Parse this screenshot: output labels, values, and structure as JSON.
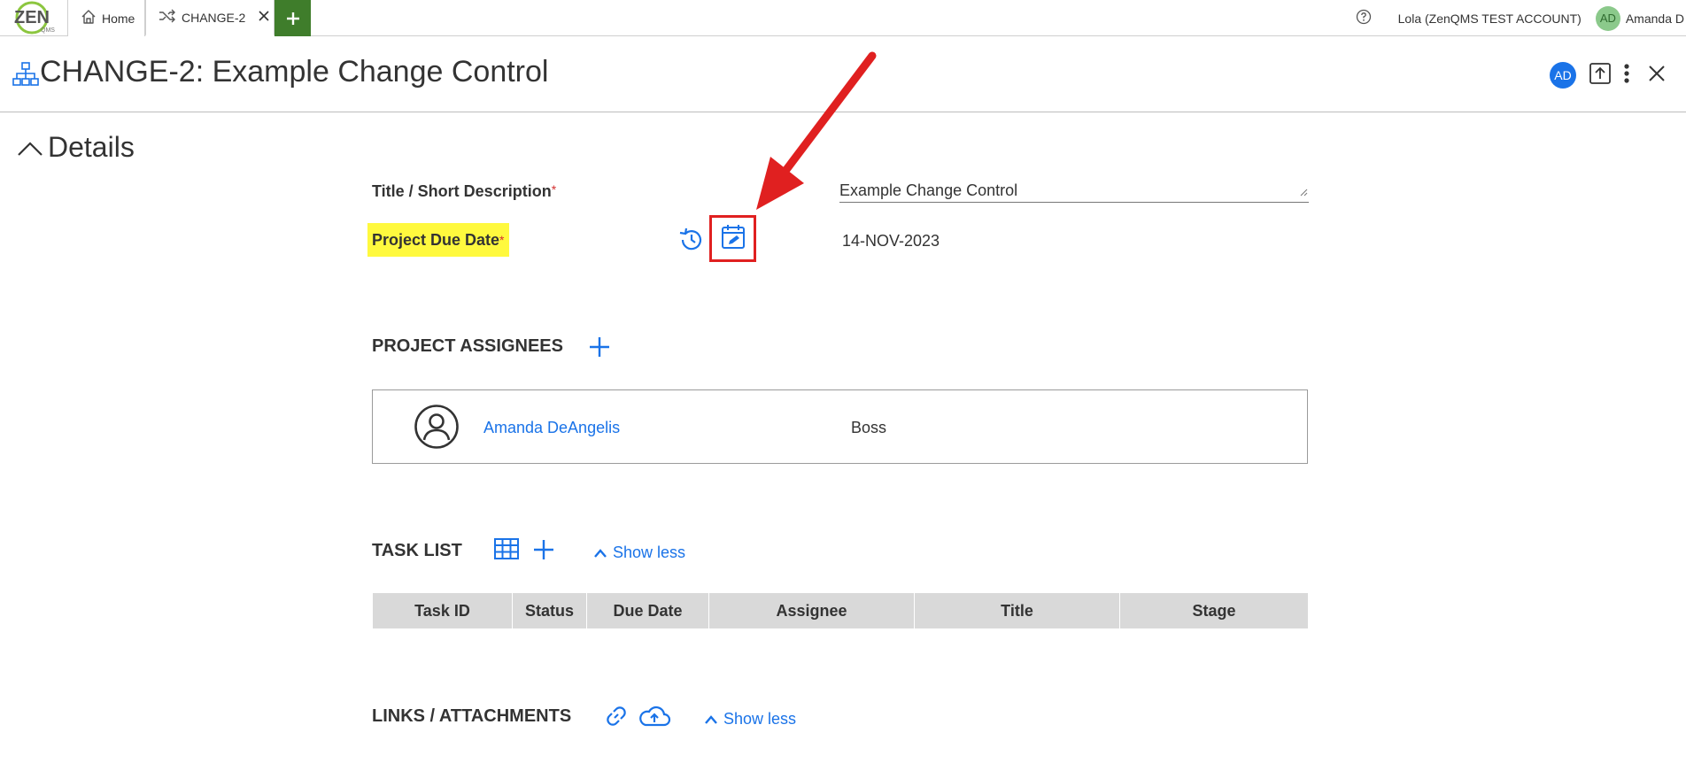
{
  "topbar": {
    "logo_text": "ZEN",
    "logo_sub": "QMS",
    "tabs": [
      {
        "label": "Home",
        "icon": "home-icon"
      },
      {
        "label": "CHANGE-2",
        "icon": "shuffle-icon",
        "close_icon": "close-icon"
      }
    ],
    "add_tab_icon": "plus-icon",
    "help_icon": "help-icon",
    "account": "Lola (ZenQMS TEST ACCOUNT)",
    "user_initials": "AD",
    "user_name": "Amanda D"
  },
  "header": {
    "title": "CHANGE-2: Example Change Control",
    "icon": "hierarchy-icon",
    "avatar_initials": "AD",
    "actions": [
      "upload-icon",
      "more-vert-icon",
      "close-icon"
    ]
  },
  "details": {
    "section_title": "Details",
    "title_label": "Title / Short Description",
    "required_mark": "*",
    "title_value": "Example Change Control",
    "due_label": "Project Due Date",
    "due_value": "14-NOV-2023",
    "history_icon": "history-icon",
    "edit_date_icon": "calendar-edit-icon"
  },
  "assignees": {
    "label": "PROJECT ASSIGNEES",
    "items": [
      {
        "name": "Amanda DeAngelis",
        "role": "Boss"
      }
    ]
  },
  "task_list": {
    "label": "TASK LIST",
    "show_less": "Show less",
    "columns": [
      "Task ID",
      "Status",
      "Due Date",
      "Assignee",
      "Title",
      "Stage"
    ]
  },
  "links": {
    "label": "LINKS / ATTACHMENTS",
    "show_less": "Show less"
  },
  "colors": {
    "accent": "#1a73e8",
    "highlight": "#fff93e",
    "annotation": "#e02020",
    "add_tab": "#3f7d2b"
  }
}
